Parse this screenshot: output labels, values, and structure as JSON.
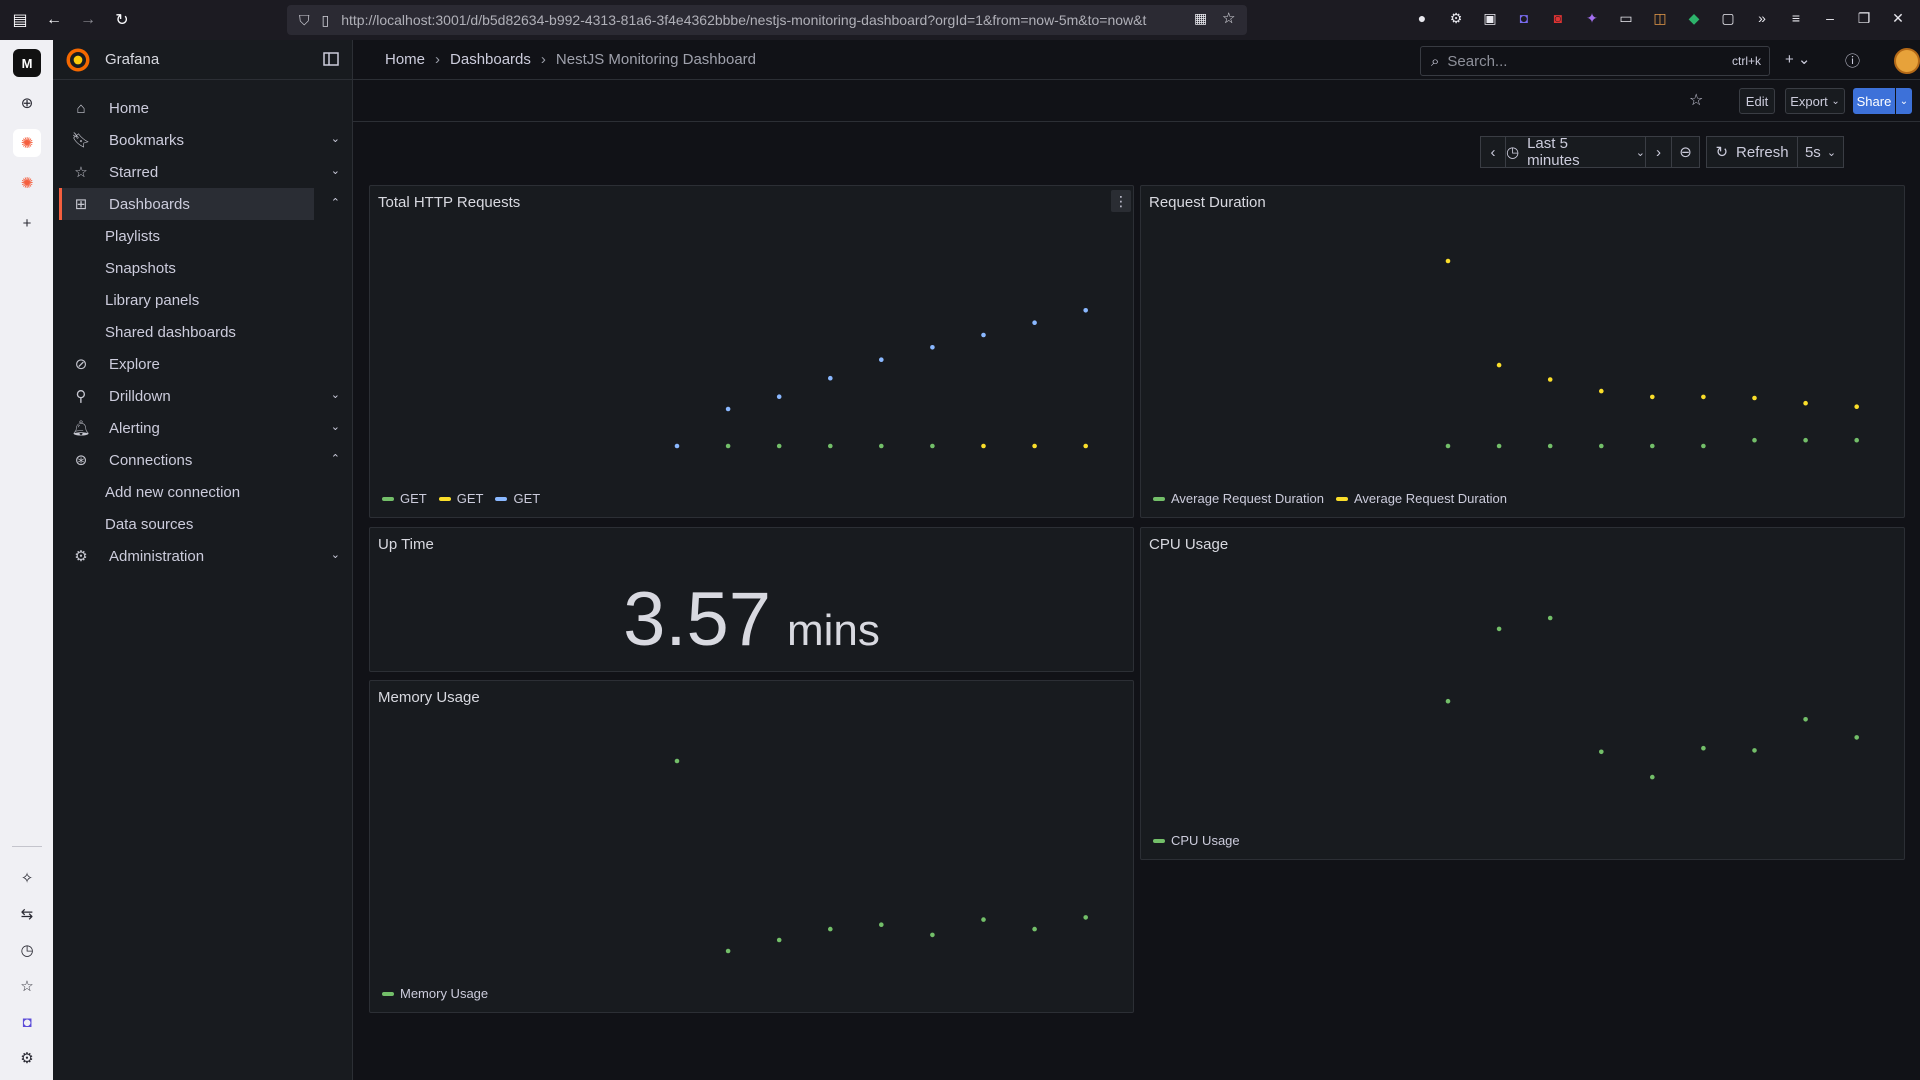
{
  "browser": {
    "url": "http://localhost:3001/d/b5d82634-b992-4313-81a6-3f4e4362bbbe/nestjs-monitoring-dashboard?orgId=1&from=now-5m&to=now&t"
  },
  "grafana": {
    "brand": "Grafana",
    "nav": {
      "home": "Home",
      "bookmarks": "Bookmarks",
      "starred": "Starred",
      "dashboards": "Dashboards",
      "playlists": "Playlists",
      "snapshots": "Snapshots",
      "library_panels": "Library panels",
      "shared_dashboards": "Shared dashboards",
      "explore": "Explore",
      "drilldown": "Drilldown",
      "alerting": "Alerting",
      "connections": "Connections",
      "add_new_connection": "Add new connection",
      "data_sources": "Data sources",
      "administration": "Administration"
    },
    "breadcrumbs": [
      "Home",
      "Dashboards",
      "NestJS Monitoring Dashboard"
    ],
    "search": {
      "placeholder": "Search...",
      "shortcut": "ctrl+k"
    },
    "toolbar": {
      "edit": "Edit",
      "export": "Export",
      "share": "Share"
    },
    "time_picker": {
      "range": "Last 5 minutes",
      "refresh": "Refresh",
      "interval": "5s"
    },
    "accent": "#f55f3e"
  },
  "panels": {
    "http": {
      "title": "Total HTTP Requests",
      "legend": [
        "GET",
        "GET",
        "GET"
      ]
    },
    "duration": {
      "title": "Request Duration",
      "legend": [
        "Average Request Duration",
        "Average Request Duration"
      ]
    },
    "uptime": {
      "title": "Up Time",
      "value": "3.57",
      "unit": "mins"
    },
    "cpu": {
      "title": "CPU Usage",
      "legend": [
        "CPU Usage"
      ]
    },
    "memory": {
      "title": "Memory Usage",
      "legend": [
        "Memory Usage"
      ]
    }
  },
  "chart_data": [
    {
      "type": "scatter",
      "title": "Total HTTP Requests",
      "x_index": [
        0,
        1,
        2,
        3,
        4,
        5,
        6,
        7,
        8,
        9,
        10,
        11,
        12
      ],
      "series": [
        {
          "name": "GET",
          "color": "#73bf69",
          "values": [
            null,
            0,
            0,
            0,
            0,
            0,
            null,
            null,
            null,
            null,
            null,
            null,
            null
          ]
        },
        {
          "name": "GET",
          "color": "#fade2a",
          "values": [
            null,
            null,
            null,
            null,
            null,
            null,
            0,
            0,
            0,
            0,
            0,
            0,
            0
          ]
        },
        {
          "name": "GET",
          "color": "#8ab8ff",
          "values": [
            0,
            6,
            8,
            11,
            14,
            16,
            18,
            20,
            22,
            24,
            26,
            28,
            30
          ]
        }
      ]
    },
    {
      "type": "scatter",
      "title": "Request Duration",
      "x_index": [
        0,
        1,
        2,
        3,
        4,
        5,
        6,
        7,
        8,
        9,
        10,
        11,
        12
      ],
      "series": [
        {
          "name": "Average Request Duration",
          "color": "#73bf69",
          "values": [
            4,
            4,
            4,
            4,
            4,
            4,
            5,
            5,
            5,
            5,
            5,
            5,
            5
          ]
        },
        {
          "name": "Average Request Duration",
          "color": "#fade2a",
          "values": [
            36,
            18,
            15.5,
            13.5,
            12.5,
            12.5,
            12.3,
            11.4,
            10.8,
            10.3,
            10.1,
            9.9,
            9.8
          ]
        }
      ]
    },
    {
      "type": "scatter",
      "title": "CPU Usage",
      "x_index": [
        0,
        1,
        2,
        3,
        4,
        5,
        6,
        7,
        8,
        9,
        10,
        11,
        12
      ],
      "series": [
        {
          "name": "CPU Usage",
          "color": "#73bf69",
          "values": [
            11,
            21,
            22.5,
            4,
            0.5,
            4.5,
            4.2,
            8.5,
            6,
            5.5,
            -1,
            -0.8,
            -0.2
          ]
        }
      ]
    },
    {
      "type": "scatter",
      "title": "Memory Usage",
      "x_index": [
        0,
        1,
        2,
        3,
        4,
        5,
        6,
        7,
        8,
        9,
        10,
        11,
        12
      ],
      "series": [
        {
          "name": "Memory Usage",
          "color": "#73bf69",
          "values": [
            26,
            0,
            1.5,
            3,
            3.6,
            2.2,
            4.3,
            3,
            4.6,
            2.6,
            1.4,
            3.3,
            2,
            3.2
          ]
        }
      ]
    }
  ]
}
